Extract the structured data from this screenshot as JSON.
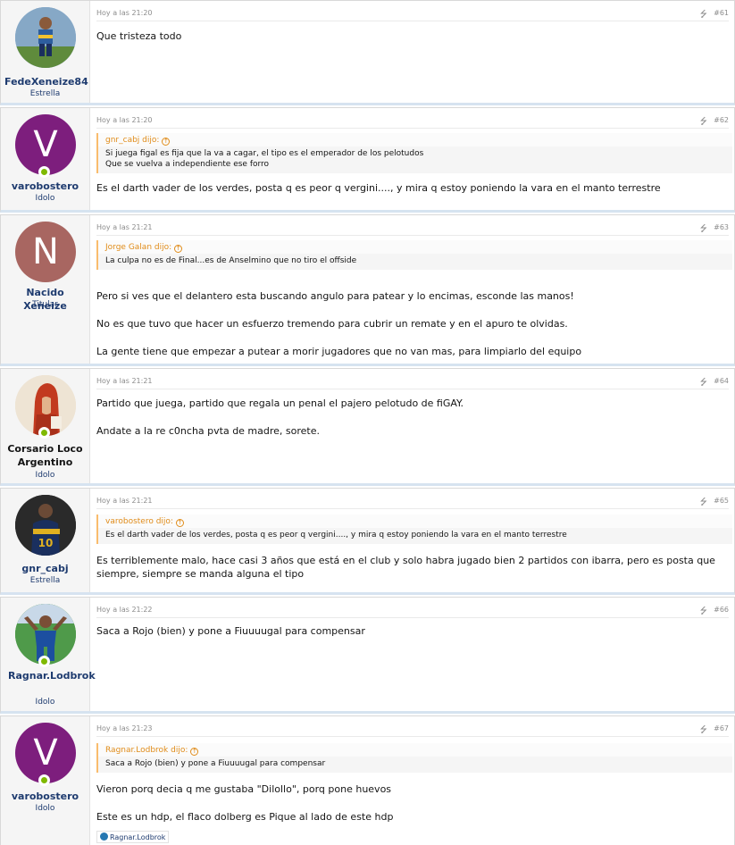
{
  "posts": [
    {
      "user": "FedeXeneize84",
      "title": "Estrella",
      "time": "Hoy a las 21:20",
      "num": "#61",
      "avatar": {
        "type": "photo",
        "icon": "player-photo-avatar",
        "colors": [
          "#2d5e9e",
          "#f2c230"
        ]
      },
      "online": false,
      "paragraphs": [
        "Que tristeza todo"
      ]
    },
    {
      "user": "varobostero",
      "title": "Idolo",
      "time": "Hoy a las 21:20",
      "num": "#62",
      "avatar": {
        "type": "letter",
        "letter": "V",
        "color": "#7d1e7d"
      },
      "online": true,
      "quote": {
        "author": "gnr_cabj dijo:",
        "lines": [
          "Si juega figal es fija que la va a cagar, el tipo es el emperador de los pelotudos",
          "Que se vuelva a independiente ese forro"
        ]
      },
      "paragraphs": [
        "Es el darth vader de los verdes, posta q es peor q vergini...., y mira q estoy poniendo la vara en el manto terrestre"
      ]
    },
    {
      "user": "Nacido Xeneize",
      "title": "Titular",
      "time": "Hoy a las 21:21",
      "num": "#63",
      "avatar": {
        "type": "letter",
        "letter": "N",
        "color": "#a86661"
      },
      "online": false,
      "quote": {
        "author": "Jorge Galan dijo:",
        "lines": [
          "La culpa no es de Final...es de Anselmino que no tiro el offside"
        ]
      },
      "paragraphs": [
        "Pero si ves que el delantero esta buscando angulo para patear y lo encimas, esconde las manos!",
        "No es que tuvo que hacer un esfuerzo tremendo para cubrir un remate y en el apuro te olvidas.",
        "La gente tiene que empezar a putear a morir jugadores que no van mas, para limpiarlo del equipo"
      ]
    },
    {
      "user": "Corsario Loco Argentino",
      "title": "Idolo",
      "time": "Hoy a las 21:21",
      "num": "#64",
      "avatar": {
        "type": "photo",
        "icon": "dante-portrait-avatar",
        "colors": [
          "#c23a1f",
          "#e8dcc8"
        ]
      },
      "online": true,
      "paragraphs": [
        "Partido que juega, partido que regala un penal el pajero pelotudo de fiGAY.",
        "Andate a la re c0ncha pvta de madre, sorete."
      ]
    },
    {
      "user": "gnr_cabj",
      "title": "Estrella",
      "time": "Hoy a las 21:21",
      "num": "#65",
      "avatar": {
        "type": "photo",
        "icon": "player-number-10-avatar",
        "colors": [
          "#1a2f5e",
          "#e0b020"
        ]
      },
      "online": false,
      "quote": {
        "author": "varobostero dijo:",
        "lines": [
          "Es el darth vader de los verdes, posta q es peor q vergini...., y mira q estoy poniendo la vara en el manto terrestre"
        ]
      },
      "paragraphs": [
        "Es terriblemente malo, hace casi 3 años que está en el club y solo habra jugado bien 2 partidos con ibarra, pero es posta que siempre, siempre se manda alguna el tipo"
      ]
    },
    {
      "user": "Ragnar.Lodbrok",
      "title": "Idolo",
      "time": "Hoy a las 21:22",
      "num": "#66",
      "avatar": {
        "type": "photo",
        "icon": "player-celebrating-avatar",
        "colors": [
          "#3a8a3a",
          "#1c4fa0"
        ]
      },
      "online": true,
      "paragraphs": [
        "Saca a Rojo (bien) y pone a Fiuuuugal para compensar"
      ]
    },
    {
      "user": "varobostero",
      "title": "Idolo",
      "time": "Hoy a las 21:23",
      "num": "#67",
      "avatar": {
        "type": "letter",
        "letter": "V",
        "color": "#7d1e7d"
      },
      "online": true,
      "quote": {
        "author": "Ragnar.Lodbrok dijo:",
        "lines": [
          "Saca a Rojo (bien) y pone a Fiuuuugal para compensar"
        ]
      },
      "paragraphs": [
        "Vieron porq decia q me gustaba \"Dilollo\", porq pone huevos",
        "Este es un hdp, el flaco dolberg es Pique al lado de este hdp"
      ],
      "reaction": "Ragnar.Lodbrok"
    }
  ]
}
